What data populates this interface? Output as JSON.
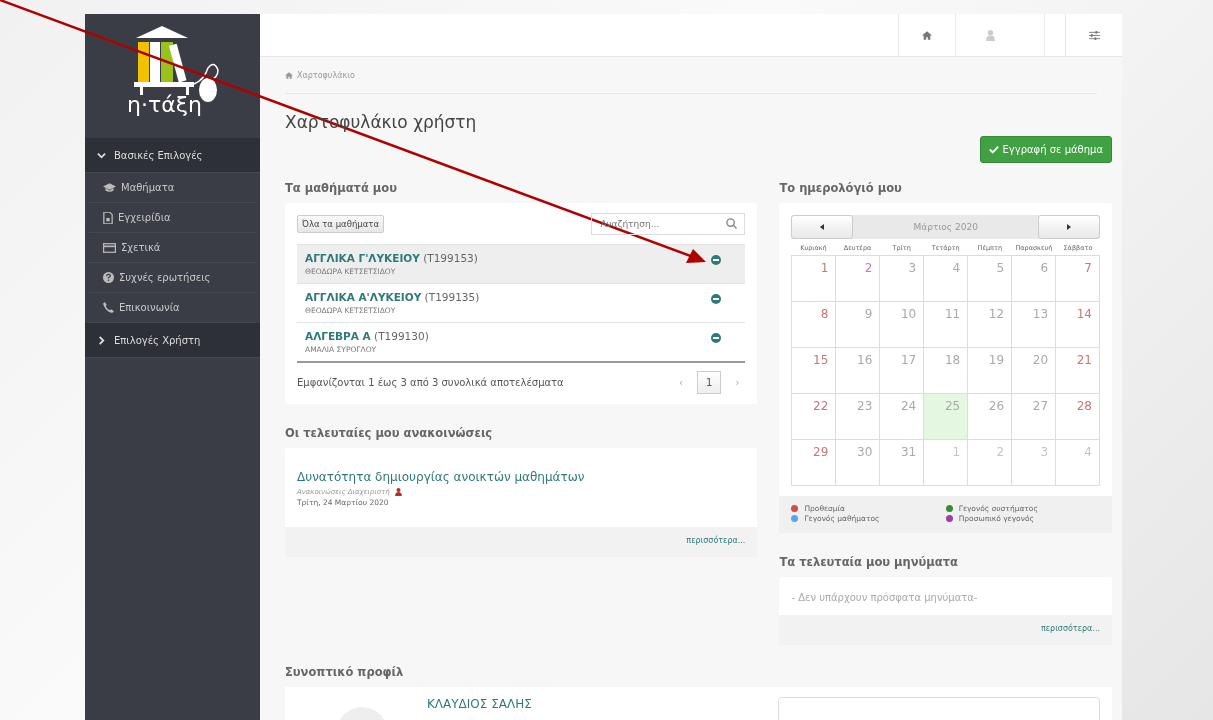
{
  "logo": {
    "text": "η·τάξη"
  },
  "sidebar": {
    "groups": [
      {
        "label": "Βασικές Επιλογές",
        "expanded": true,
        "items": [
          {
            "label": "Μαθήματα"
          },
          {
            "label": "Εγχειρίδια"
          },
          {
            "label": "Σχετικά"
          },
          {
            "label": "Συχνές ερωτήσεις"
          },
          {
            "label": "Επικοινωνία"
          }
        ]
      },
      {
        "label": "Επιλογές Χρήστη",
        "expanded": false
      }
    ]
  },
  "breadcrumb": "Χαρτοφυλάκιο",
  "page_title": "Χαρτοφυλάκιο χρήστη",
  "enroll_button": "Εγγραφή σε μάθημα",
  "courses": {
    "heading": "Τα μαθήματά μου",
    "all_button": "Όλα τα μαθήματα",
    "search": {
      "placeholder": "Αναζήτηση..."
    },
    "rows": [
      {
        "title": "ΑΓΓΛΙΚΑ Γ'ΛΥΚΕΙΟΥ",
        "code": "(T199153)",
        "teacher": "ΘΕΟΔΩΡΑ ΚΕΤΣΕΤΣΙΔΟΥ",
        "selected": true
      },
      {
        "title": "ΑΓΓΛΙΚΑ Α'ΛΥΚΕΙΟΥ",
        "code": "(T199135)",
        "teacher": "ΘΕΟΔΩΡΑ ΚΕΤΣΕΤΣΙΔΟΥ",
        "selected": false
      },
      {
        "title": "ΑΛΓΕΒΡΑ Α",
        "code": "(T199130)",
        "teacher": "ΑΜΑΛΙΑ ΣΥΡΟΓΛΟΥ",
        "selected": false
      }
    ],
    "summary": "Εμφανίζονται 1 έως 3 από 3 συνολικά αποτελέσματα",
    "pager": {
      "prev": "‹",
      "pages": [
        {
          "label": "1",
          "selected": true
        }
      ],
      "next": "›"
    }
  },
  "announcements": {
    "heading": "Οι τελευταίες μου ανακοινώσεις",
    "items": [
      {
        "title": "Δυνατότητα δημιουργίας ανοικτών μαθημάτων",
        "source": "Ανακοινώσεις Διαχειριστή",
        "date": "Τρίτη, 24 Μαρτίου 2020"
      }
    ],
    "more": "περισσότερα..."
  },
  "calendar": {
    "heading": "Το ημερολόγιό μου",
    "month": "Μάρτιος 2020",
    "weekdays": [
      "Κυριακή",
      "Δευτέρα",
      "Τρίτη",
      "Τετάρτη",
      "Πέμπτη",
      "Παρασκευή",
      "Σάββατο"
    ],
    "weeks": [
      [
        {
          "day": "1",
          "kind": "weekend",
          "selected": false
        },
        {
          "day": "2",
          "kind": "event",
          "selected": false
        },
        {
          "day": "3",
          "kind": "weekday",
          "selected": false
        },
        {
          "day": "4",
          "kind": "weekday",
          "selected": false
        },
        {
          "day": "5",
          "kind": "weekday",
          "selected": false
        },
        {
          "day": "6",
          "kind": "weekday",
          "selected": false
        },
        {
          "day": "7",
          "kind": "weekend",
          "selected": false
        }
      ],
      [
        {
          "day": "8",
          "kind": "weekend",
          "selected": false
        },
        {
          "day": "9",
          "kind": "weekday",
          "selected": false
        },
        {
          "day": "10",
          "kind": "weekday",
          "selected": false
        },
        {
          "day": "11",
          "kind": "weekday",
          "selected": false
        },
        {
          "day": "12",
          "kind": "weekday",
          "selected": false
        },
        {
          "day": "13",
          "kind": "weekday",
          "selected": false
        },
        {
          "day": "14",
          "kind": "weekend",
          "selected": false
        }
      ],
      [
        {
          "day": "15",
          "kind": "weekend",
          "selected": false
        },
        {
          "day": "16",
          "kind": "weekday",
          "selected": false
        },
        {
          "day": "17",
          "kind": "weekday",
          "selected": false
        },
        {
          "day": "18",
          "kind": "weekday",
          "selected": false
        },
        {
          "day": "19",
          "kind": "weekday",
          "selected": false
        },
        {
          "day": "20",
          "kind": "weekday",
          "selected": false
        },
        {
          "day": "21",
          "kind": "weekend",
          "selected": false
        }
      ],
      [
        {
          "day": "22",
          "kind": "weekend",
          "selected": false
        },
        {
          "day": "23",
          "kind": "weekday",
          "selected": false
        },
        {
          "day": "24",
          "kind": "weekday",
          "selected": false
        },
        {
          "day": "25",
          "kind": "weekday",
          "selected": true
        },
        {
          "day": "26",
          "kind": "weekday",
          "selected": false
        },
        {
          "day": "27",
          "kind": "weekday",
          "selected": false
        },
        {
          "day": "28",
          "kind": "weekend",
          "selected": false
        }
      ],
      [
        {
          "day": "29",
          "kind": "weekend",
          "selected": false
        },
        {
          "day": "30",
          "kind": "weekday",
          "selected": false
        },
        {
          "day": "31",
          "kind": "weekday",
          "selected": false
        },
        {
          "day": "1",
          "kind": "other",
          "selected": false
        },
        {
          "day": "2",
          "kind": "other",
          "selected": false
        },
        {
          "day": "3",
          "kind": "other",
          "selected": false
        },
        {
          "day": "4",
          "kind": "other",
          "selected": false
        }
      ]
    ],
    "legend": [
      {
        "label": "Προθεσμία",
        "color": "#c9504f"
      },
      {
        "label": "Γεγονός συστήματος",
        "color": "#3a8a3a"
      },
      {
        "label": "Γεγονός μαθήματος",
        "color": "#5aa6ee"
      },
      {
        "label": "Προσωπικό γεγονός",
        "color": "#9b3fa4"
      }
    ]
  },
  "messages": {
    "heading": "Τα τελευταία μου μηνύματα",
    "empty": "- Δεν υπάρχουν πρόσφατα μηνύματα-",
    "more": "περισσότερα..."
  },
  "profile": {
    "heading": "Συνοπτικό προφίλ",
    "name": "ΚΛΑΥΔΙΟΣ ΣΑΛΗΣ"
  }
}
